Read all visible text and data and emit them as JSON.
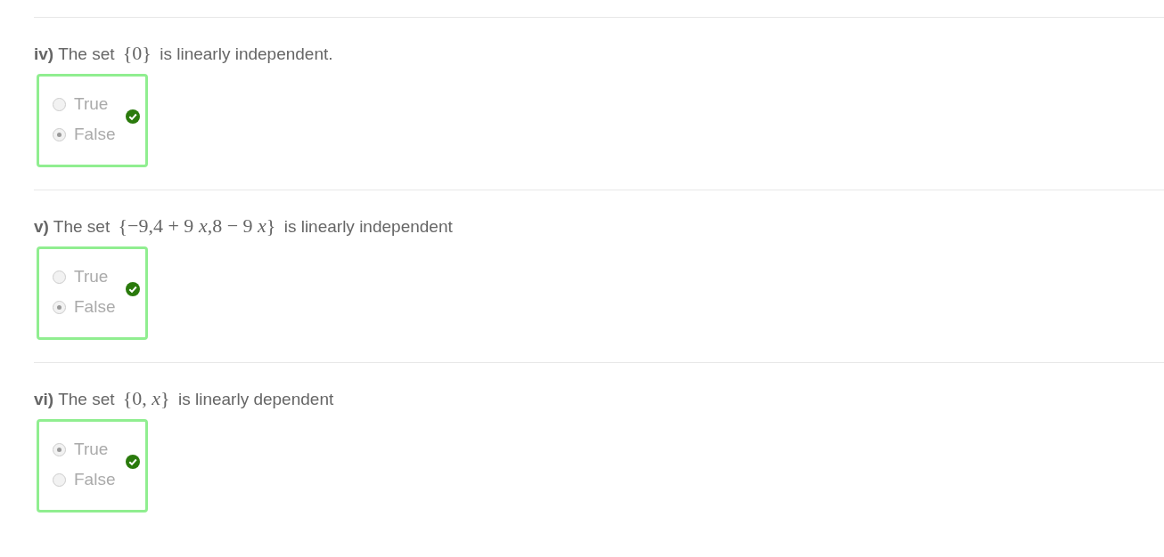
{
  "questions": [
    {
      "number": "iv)",
      "text_before": "The set",
      "math": "{0}",
      "text_after": "is linearly independent.",
      "correct": true,
      "options": [
        {
          "label": "True",
          "selected": false
        },
        {
          "label": "False",
          "selected": true
        }
      ]
    },
    {
      "number": "v)",
      "text_before": "The set",
      "math": "{−9,4 + 9 *x*,8 − 9 *x*}",
      "text_after": "is linearly independent",
      "correct": true,
      "options": [
        {
          "label": "True",
          "selected": false
        },
        {
          "label": "False",
          "selected": true
        }
      ]
    },
    {
      "number": "vi)",
      "text_before": "The set",
      "math": "{0, *x*}",
      "text_after": "is linearly dependent",
      "correct": true,
      "options": [
        {
          "label": "True",
          "selected": true
        },
        {
          "label": "False",
          "selected": false
        }
      ]
    }
  ]
}
